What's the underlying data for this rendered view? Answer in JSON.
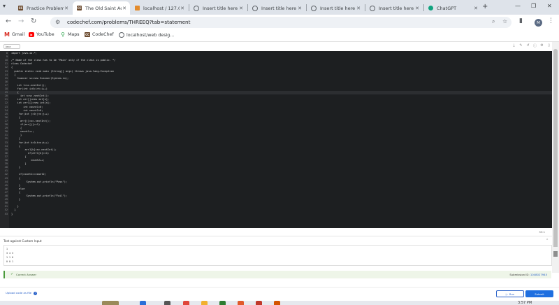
{
  "tabs": [
    {
      "title": "Practice Problem",
      "icon": "codechef-icon",
      "active": false
    },
    {
      "title": "The Old Saint Ac",
      "icon": "codechef-icon",
      "active": true
    },
    {
      "title": "localhost / 127.0",
      "icon": "phpmyadmin-icon",
      "active": false
    },
    {
      "title": "Insert title here",
      "icon": "globe-icon",
      "active": false
    },
    {
      "title": "Insert title here",
      "icon": "globe-icon",
      "active": false
    },
    {
      "title": "Insert title here",
      "icon": "globe-icon",
      "active": false
    },
    {
      "title": "Insert title here",
      "icon": "globe-icon",
      "active": false
    },
    {
      "title": "ChatGPT",
      "icon": "chatgpt-icon",
      "active": false
    }
  ],
  "omnibox": {
    "url": "codechef.com/problems/THREEQ?tab=statement"
  },
  "profile": {
    "initial": "M"
  },
  "bookmarks": [
    {
      "label": "Gmail",
      "icon": "gmail-icon"
    },
    {
      "label": "YouTube",
      "icon": "youtube-icon"
    },
    {
      "label": "Maps",
      "icon": "maps-icon"
    },
    {
      "label": "CodeChef",
      "icon": "codechef-icon"
    },
    {
      "label": "localhost/web desig...",
      "icon": "globe-icon"
    }
  ],
  "editor": {
    "language": "Java",
    "current_line": 19,
    "lines": [
      {
        "n": "8",
        "code": "import java.io.*;"
      },
      {
        "n": "9",
        "code": ""
      },
      {
        "n": "10",
        "code": "/* Name of the class has to be \"Main\" only if the class is public. */"
      },
      {
        "n": "11",
        "code": "class Codechef"
      },
      {
        "n": "12",
        "code": "{"
      },
      {
        "n": "13",
        "code": "  public static void main (String[] args) throws java.lang.Exception"
      },
      {
        "n": "14",
        "code": "  {"
      },
      {
        "n": "15",
        "code": "    Scanner sc=new Scanner(System.in);"
      },
      {
        "n": "16",
        "code": ""
      },
      {
        "n": "17",
        "code": "    int t=sc.nextInt();"
      },
      {
        "n": "18",
        "code": "    for(int i=0;i<t;i++)"
      },
      {
        "n": "19",
        "code": "    {"
      },
      {
        "n": "20",
        "code": "      int n=sc.nextInt();"
      },
      {
        "n": "21",
        "code": "    int arr[]=new int[n];"
      },
      {
        "n": "22",
        "code": "    int arr1[]=new int[n];"
      },
      {
        "n": "23",
        "code": "        int count1=0;"
      },
      {
        "n": "24",
        "code": "        int count2=0;"
      },
      {
        "n": "25",
        "code": "     for(int j=0;j<n;j++)"
      },
      {
        "n": "26",
        "code": "     {"
      },
      {
        "n": "27",
        "code": "      arr[j]=sc.nextInt();"
      },
      {
        "n": "28",
        "code": "      if(arr[j]==1)"
      },
      {
        "n": "29",
        "code": "      {"
      },
      {
        "n": "30",
        "code": "      count1++;"
      },
      {
        "n": "31",
        "code": "      }"
      },
      {
        "n": "32",
        "code": "     }"
      },
      {
        "n": "33",
        "code": "     for(int k=0;k<n;k++)"
      },
      {
        "n": "34",
        "code": "     {"
      },
      {
        "n": "35",
        "code": "         arr1[k]=sc.nextInt();"
      },
      {
        "n": "36",
        "code": "           if(arr1[k]==1)"
      },
      {
        "n": "37",
        "code": "         {"
      },
      {
        "n": "38",
        "code": "             count2++;"
      },
      {
        "n": "39",
        "code": "         }"
      },
      {
        "n": "40",
        "code": "     }"
      },
      {
        "n": "41",
        "code": ""
      },
      {
        "n": "42",
        "code": "     if(count1==count2)"
      },
      {
        "n": "43",
        "code": "     {"
      },
      {
        "n": "44",
        "code": "          System.out.println(\"Pass\");"
      },
      {
        "n": "45",
        "code": "     }"
      },
      {
        "n": "46",
        "code": "     else"
      },
      {
        "n": "47",
        "code": "     {"
      },
      {
        "n": "48",
        "code": "          System.out.println(\"Fail\");"
      },
      {
        "n": "49",
        "code": "     }"
      },
      {
        "n": "50",
        "code": ""
      },
      {
        "n": "51",
        "code": "    }"
      },
      {
        "n": "52",
        "code": "  }"
      },
      {
        "n": "53",
        "code": "}"
      }
    ],
    "cursor_position": "53:1"
  },
  "custom_input": {
    "label": "Test against Custom Input",
    "lines": [
      "1",
      "3 4 3",
      "1 1 0",
      "0 0 1"
    ]
  },
  "result": {
    "status": "Correct Answer",
    "submission_label": "Submission ID:",
    "submission_id": "1048027945"
  },
  "footer": {
    "upload_label": "Upload code as file",
    "run_label": "Run",
    "submit_label": "Submit"
  },
  "taskbar": {
    "time": "3:57 PM"
  },
  "colors": {
    "accent": "#1f6fe0",
    "success": "#4a9a3c",
    "editor_bg": "#1d1f21"
  }
}
